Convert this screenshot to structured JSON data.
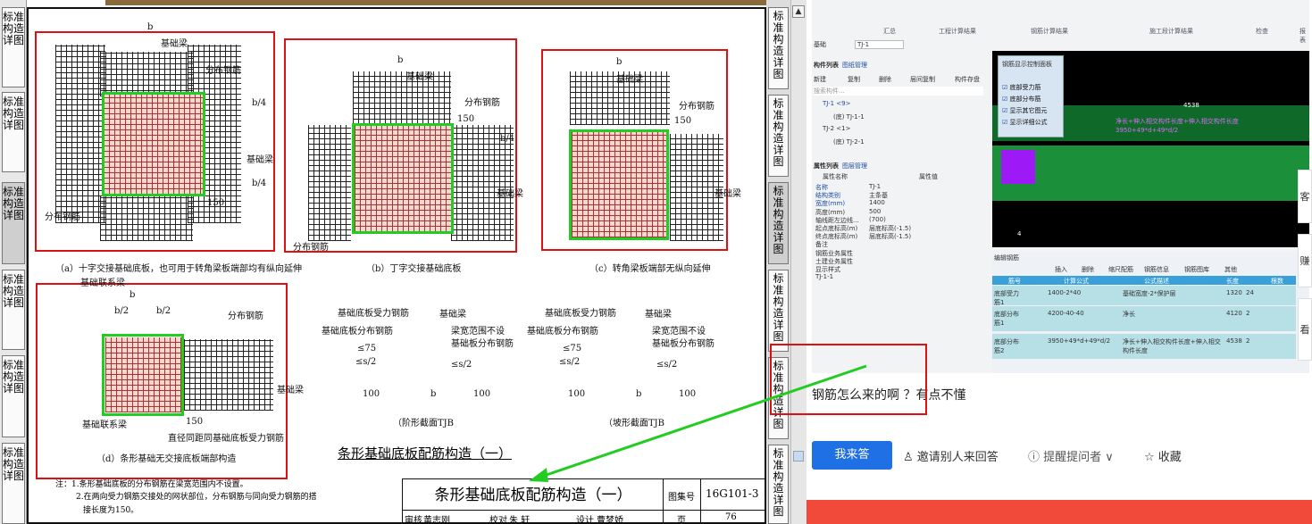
{
  "left_tabs": [
    "标准构造详图",
    "标准构造详图",
    "标准构造详图",
    "标准构造详图",
    "标准构造详图",
    "标准构造详图"
  ],
  "right_tabs": [
    "标准构造详图",
    "标准构造详图",
    "标准构造详图",
    "标准构造详图",
    "标准构造详图",
    "标准构造详图"
  ],
  "drawing": {
    "labels": {
      "a_beam": "基础梁",
      "a_dist": "分布钢筋",
      "a_dist2": "分布钢筋",
      "a_beam2": "基础梁",
      "b": "b",
      "b4": "b/4",
      "n150": "150",
      "b_beam": "基础梁",
      "b_dist": "分布钢筋",
      "b_dist2": "分布钢筋",
      "b_beam2": "基础梁",
      "c_beam": "基础梁",
      "c_dist": "分布钢筋",
      "c_beam2": "基础梁",
      "d_link": "基础联系梁",
      "d_half": "b/2",
      "d_dist": "分布钢筋",
      "d_beam": "基础梁",
      "d_link2": "基础联系梁",
      "d_note": "直径同距同基础底板受力钢筋",
      "s_main": "基础底板受力钢筋",
      "s_dist": "基础底板分布钢筋",
      "s_beam": "基础梁",
      "s_nobeam": "梁宽范围不设",
      "s_board": "基础板分布钢筋",
      "le75": "≤75",
      "les2": "≤s/2",
      "n100": "100"
    },
    "captions": {
      "a": "（a）十字交接基础底板，也可用于转角梁板端部均有纵向延伸",
      "b": "（b）丁字交接基础底板",
      "c": "（c）转角梁板端部无纵向延伸",
      "d": "（d）条形基础无交接底板端部构造",
      "e": "（阶形截面TJB",
      "f": "（坡形截面TJB"
    },
    "center_title": "条形基础底板配筋构造（一）",
    "notes": [
      "注：1.条形基础底板的分布钢筋在梁宽范围内不设置。",
      "2.在两向受力钢筋交接处的网状部位，分布钢筋与同向受力钢筋的搭",
      "接长度为150。"
    ],
    "titleblock": {
      "title": "条形基础底板配筋构造（一）",
      "atlas_label": "图集号",
      "atlas_no": "16G101-3",
      "review": "审核",
      "reviewer": "黄志刚",
      "check": "校对",
      "checker": "朱 轩",
      "design": "设计",
      "designer": "曹梦娇",
      "page_label": "页",
      "page_no": "76"
    }
  },
  "software": {
    "tabs": [
      "汇总",
      "工程计算结果",
      "钢筋计算结果",
      "施工段计算结果",
      "检查",
      "报表"
    ],
    "filter_label": "基础",
    "filter_value": "TJ-1",
    "component_list_tab": "构件列表",
    "drawing_mgmt_tab": "图纸管理",
    "toolbar": [
      "新建",
      "复制",
      "删除",
      "层间复制",
      "构件存盘"
    ],
    "search_placeholder": "搜索构件...",
    "tree": [
      "TJ-1 <9>",
      "(底) TJ-1-1",
      "TJ-2 <1>",
      "(底) TJ-2-1"
    ],
    "prop_tab": "属性列表",
    "prop_tab2": "图层管理",
    "prop_head_name": "属性名称",
    "prop_head_value": "属性值",
    "props": [
      [
        "名称",
        "TJ-1"
      ],
      [
        "结构类别",
        "主条基"
      ],
      [
        "宽度(mm)",
        "1400"
      ],
      [
        "高度(mm)",
        "500"
      ],
      [
        "轴线距左边线...",
        "(700)"
      ],
      [
        "起点底标高(m)",
        "层底标高(-1.5)"
      ],
      [
        "终点底标高(m)",
        "层底标高(-1.5)"
      ],
      [
        "备注",
        ""
      ],
      [
        "钢筋业务属性",
        ""
      ],
      [
        "土建业务属性",
        ""
      ],
      [
        "显示样式",
        ""
      ],
      [
        "TJ-1-1",
        ""
      ]
    ],
    "control_panel_title": "钢筋显示控制面板",
    "control_items": [
      "底部受力筋",
      "底部分布筋",
      "显示其它图元",
      "显示详细公式"
    ],
    "dim_value": "4538",
    "formula_line1": "净长+伸入相交构件长度+伸入相交构件长度",
    "formula_line2": "3950+49*d+49*d/2",
    "edit_panel": "编辑钢筋",
    "edit_tools": [
      "插入",
      "删除",
      "缩尺配筋",
      "钢筋信息",
      "钢筋图库",
      "其他"
    ],
    "table_heads": [
      "筋号",
      "计算公式",
      "公式描述",
      "长度",
      "根数"
    ],
    "table_rows": [
      [
        "底部受力筋1",
        "1400-2*40",
        "基础宽度-2*保护层",
        "1320",
        "24"
      ],
      [
        "底部分布筋1",
        "4200-40-40",
        "净长",
        "4120",
        "2"
      ],
      [
        "底部分布筋2",
        "3950+49*d+49*d/2",
        "净长+伸入相交构件长度+伸入相交构件长度",
        "4538",
        "2"
      ]
    ],
    "axis_label": "4"
  },
  "qa": {
    "question": "钢筋怎么来的啊 ？有点不懂",
    "answer_button": "我来答",
    "invite": "邀请别人来回答",
    "remind": "提醒提问者",
    "favorite": "收藏",
    "side_cards": [
      "客",
      "赚",
      "看"
    ]
  },
  "colors": {
    "accent": "#1f6fe5",
    "annotation_red": "#d11111",
    "annotation_green": "#22cc22"
  }
}
